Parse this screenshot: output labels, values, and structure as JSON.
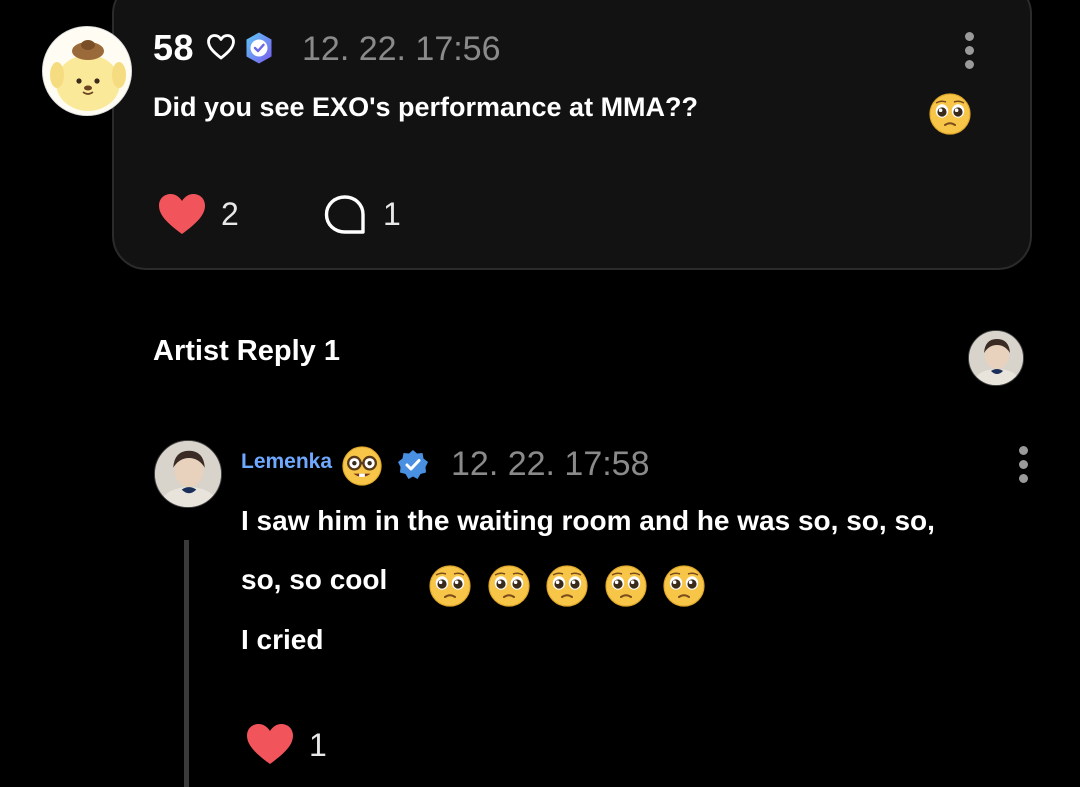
{
  "post": {
    "author_name": "58",
    "timestamp": "12. 22. 17:56",
    "text": "Did you see EXO's performance at MMA??",
    "likes": "2",
    "comments": "1",
    "icons": {
      "avatar": "pompompurin-avatar",
      "name_heart": "heart-outline-icon",
      "badge": "fan-badge-icon",
      "menu": "more-vertical-icon",
      "text_emoji": "pleading-face-emoji",
      "like": "heart-filled-icon",
      "comment": "speech-bubble-icon"
    }
  },
  "artist_reply": {
    "section_title": "Artist Reply 1",
    "author_name": "Lemenka",
    "timestamp": "12. 22. 17:58",
    "lines": [
      "I saw him in the waiting room and he was so, so, so,",
      "so, so cool",
      "I cried"
    ],
    "likes": "1",
    "icons": {
      "name_emoji": "nerd-face-emoji",
      "badge": "verified-check-icon",
      "menu": "more-vertical-icon",
      "line_emoji": "pleading-face-emoji",
      "like": "heart-filled-icon"
    }
  },
  "colors": {
    "background": "#000000",
    "card": "#121212",
    "card_border": "#2b2b2b",
    "like_heart": "#f2545b",
    "artist_name": "#6fa8ff",
    "badge_blue": "#4a90e2",
    "timestamp": "#8a8a8a"
  }
}
